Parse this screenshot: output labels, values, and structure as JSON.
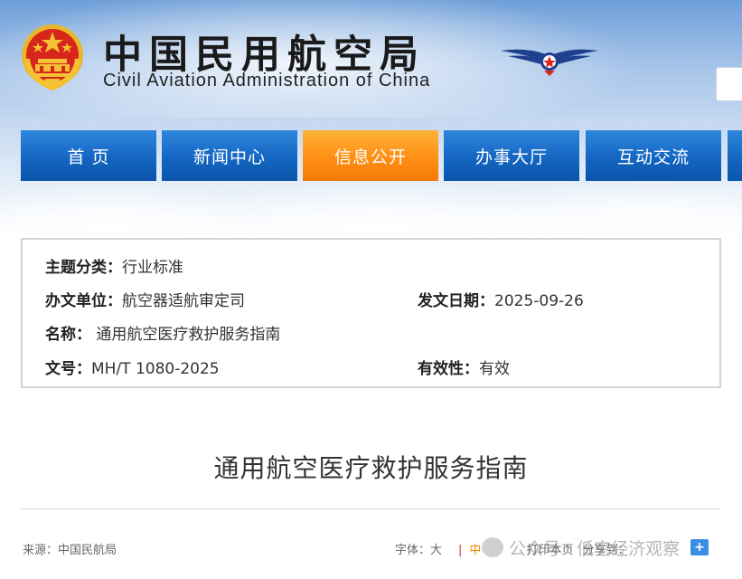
{
  "header": {
    "title_cn": "中国民用航空局",
    "title_en": "Civil Aviation Administration of China"
  },
  "nav": {
    "items": [
      {
        "label": "首 页"
      },
      {
        "label": "新闻中心"
      },
      {
        "label": "信息公开",
        "active": true
      },
      {
        "label": "办事大厅"
      },
      {
        "label": "互动交流"
      }
    ]
  },
  "info": {
    "category_label": "主题分类：",
    "category_value": "行业标准",
    "office_label": "办文单位：",
    "office_value": "航空器适航审定司",
    "date_label": "发文日期：",
    "date_value": "2025-09-26",
    "name_label": "名称：",
    "name_value": "通用航空医疗救护服务指南",
    "docno_label": "文号：",
    "docno_value": "MH/T 1080-2025",
    "validity_label": "有效性：",
    "validity_value": "有效"
  },
  "article": {
    "title": "通用航空医疗救护服务指南",
    "source": "来源：中国民航局",
    "font_label": "字体：",
    "font_large": "大",
    "font_medium": "中",
    "print": "打印本页",
    "share": "分享到："
  },
  "watermark": {
    "text": "公众号 · 低空经济观察"
  },
  "colors": {
    "nav_blue": "#1466c2",
    "nav_orange": "#ff8f14",
    "emblem_red": "#d8261c",
    "emblem_gold": "#f5c233"
  }
}
